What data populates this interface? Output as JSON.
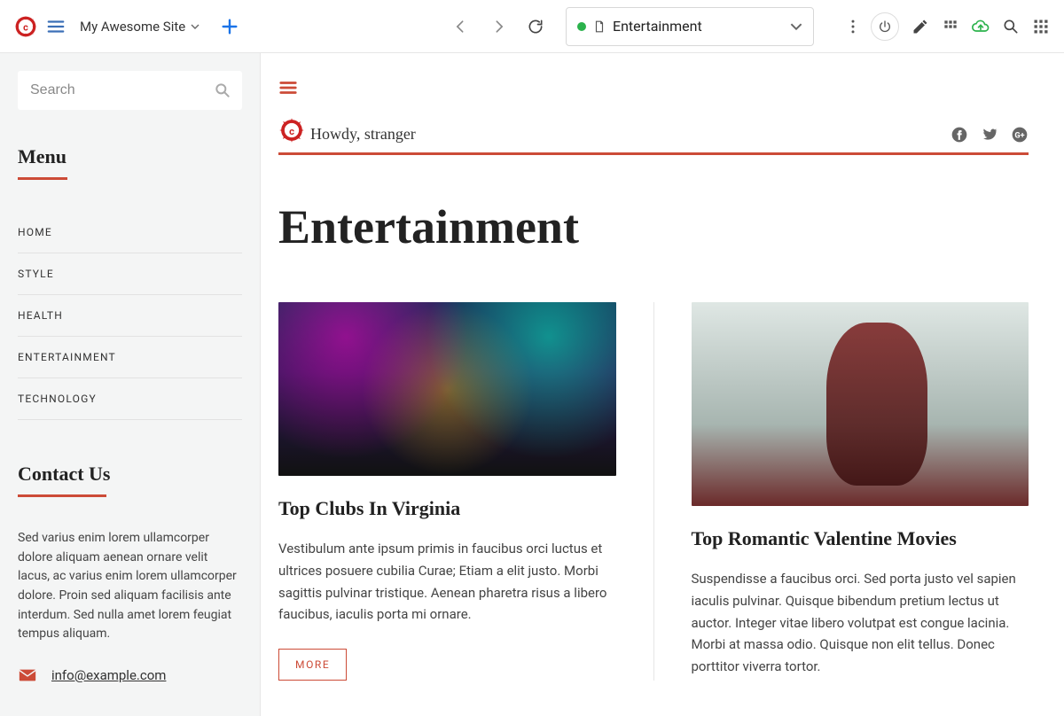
{
  "topbar": {
    "site_name": "My Awesome Site",
    "pagebar_label": "Entertainment"
  },
  "sidebar": {
    "search_placeholder": "Search",
    "menu_heading": "Menu",
    "items": [
      {
        "label": "HOME"
      },
      {
        "label": "STYLE"
      },
      {
        "label": "HEALTH"
      },
      {
        "label": "ENTERTAINMENT"
      },
      {
        "label": "TECHNOLOGY"
      }
    ],
    "contact_heading": "Contact Us",
    "contact_text": "Sed varius enim lorem ullamcorper dolore aliquam aenean ornare velit lacus, ac varius enim lorem ullamcorper dolore. Proin sed aliquam facilisis ante interdum. Sed nulla amet lorem feugiat tempus aliquam.",
    "email": "info@example.com"
  },
  "main": {
    "howdy": "Howdy, stranger",
    "page_title": "Entertainment",
    "posts": [
      {
        "title": "Top Clubs In Virginia",
        "text": "Vestibulum ante ipsum primis in faucibus orci luctus et ultrices posuere cubilia Curae; Etiam a elit justo. Morbi sagittis pulvinar tristique. Aenean pharetra risus a libero faucibus, iaculis porta mi ornare.",
        "more": "MORE"
      },
      {
        "title": "Top Romantic Valentine Movies",
        "text": "Suspendisse a faucibus orci. Sed porta justo vel sapien iaculis pulvinar. Quisque bibendum pretium lectus ut auctor. Integer vitae libero volutpat est congue lacinia. Morbi at massa odio. Quisque non elit tellus. Donec porttitor viverra tortor."
      }
    ]
  }
}
